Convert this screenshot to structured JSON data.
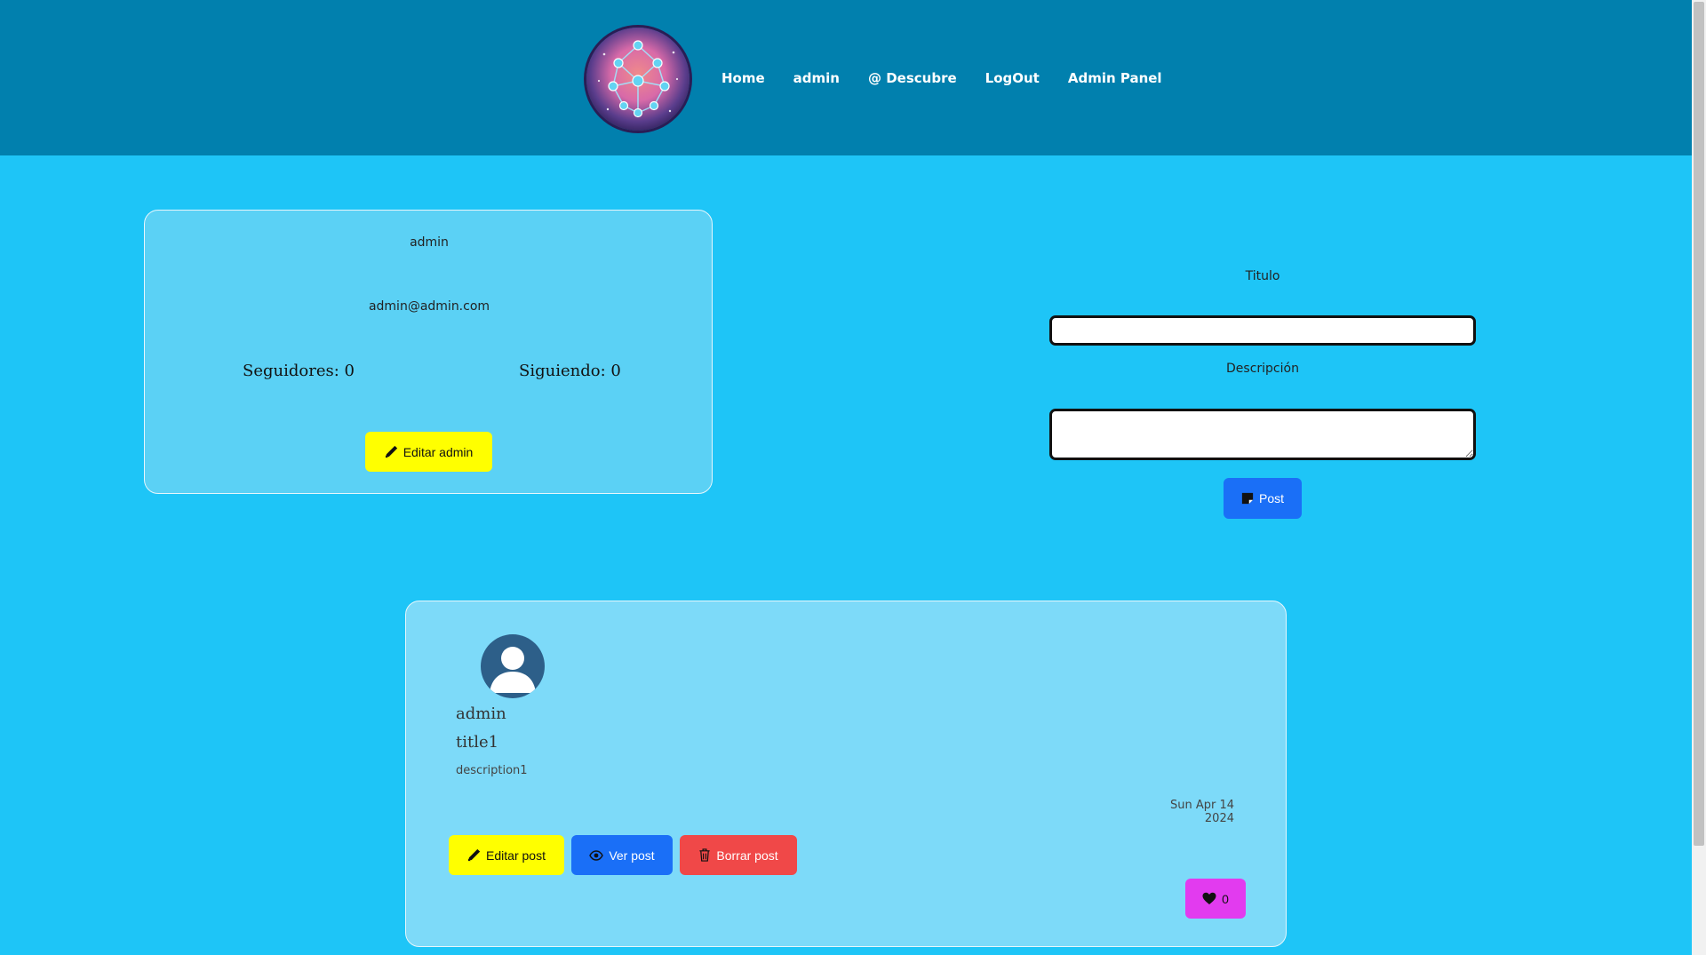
{
  "nav": {
    "links": [
      "Home",
      "admin",
      "@ Descubre",
      "LogOut",
      "Admin Panel"
    ]
  },
  "profile": {
    "username": "admin",
    "email": "admin@admin.com",
    "followers": "Seguidores: 0",
    "following": "Siguiendo: 0",
    "edit_label": "Editar admin"
  },
  "post_form": {
    "title_label": "Titulo",
    "title_value": "",
    "description_label": "Descripción",
    "description_value": "",
    "submit_label": "Post"
  },
  "post": {
    "author": "admin",
    "title": "title1",
    "description": "description1",
    "date": "Sun Apr 14 2024",
    "edit_label": "Editar post",
    "view_label": "Ver post",
    "delete_label": "Borrar post",
    "likes": "0"
  },
  "colors": {
    "navbar": "#0180ae",
    "background": "#1ec5f7",
    "yellow": "#ffff00",
    "blue": "#1a6ff7",
    "red": "#f04848",
    "pink": "#e23bef"
  },
  "icons": {
    "logo": "network-globe-logo",
    "edit": "pencil-icon",
    "post": "sticky-note-icon",
    "view": "eye-icon",
    "delete": "trash-icon",
    "like": "heart-icon",
    "avatar": "user-avatar-icon"
  }
}
